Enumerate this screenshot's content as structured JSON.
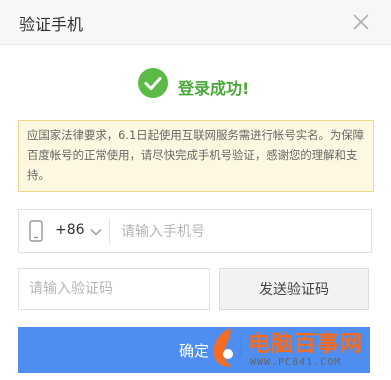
{
  "dialog": {
    "title": "验证手机",
    "success_message": "登录成功!",
    "notice": "应国家法律要求，6.1日起使用互联网服务需进行帐号实名。为保障百度帐号的正常使用，请尽快完成手机号验证，感谢您的理解和支持。",
    "phone": {
      "country_code": "+86",
      "placeholder": "请输入手机号",
      "value": ""
    },
    "code": {
      "placeholder": "请输入验证码",
      "value": ""
    },
    "send_code_label": "发送验证码",
    "confirm_label": "确定"
  },
  "watermark": {
    "title": "电脑百事网",
    "url": "WWW.PC841.COM"
  },
  "icons": {
    "close": "close-icon",
    "success": "check-circle-icon",
    "phone": "mobile-phone-icon",
    "dropdown": "chevron-down-icon",
    "watermark_logo": "pc841-logo-icon"
  },
  "colors": {
    "success": "#5bbb46",
    "notice_bg": "#fff8e1",
    "notice_border": "#f5d58a",
    "primary": "#4d8ef0",
    "watermark": "#f36c21"
  }
}
